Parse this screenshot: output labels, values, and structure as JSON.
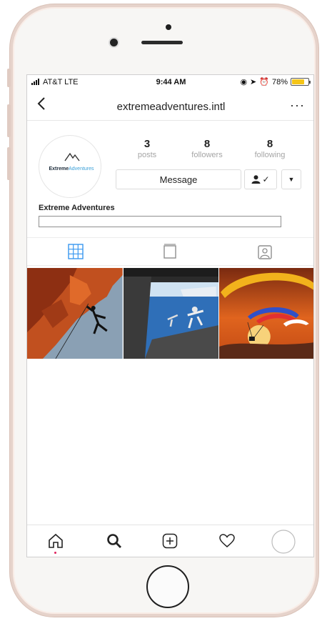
{
  "status_bar": {
    "carrier": "AT&T  LTE",
    "time": "9:44 AM",
    "battery_label": "78%",
    "battery_level": 0.78,
    "battery_color": "#f5c518"
  },
  "nav": {
    "back_icon": "chevron-left-icon",
    "title": "extremeadventures.intl",
    "more_label": "···"
  },
  "profile": {
    "avatar_logo_bold": "Extreme",
    "avatar_logo_light": "Adventures",
    "stats": [
      {
        "count": "3",
        "label": "posts"
      },
      {
        "count": "8",
        "label": "followers"
      },
      {
        "count": "8",
        "label": "following"
      }
    ],
    "message_button": "Message",
    "follow_check": "✓",
    "dropdown_arrow": "▼",
    "name": "Extreme Adventures",
    "bio": ""
  },
  "tabs": [
    {
      "icon": "grid-icon",
      "active": true
    },
    {
      "icon": "feed-icon",
      "active": false
    },
    {
      "icon": "tagged-icon",
      "active": false
    }
  ],
  "posts": [
    {
      "subject": "rock climber on cliff"
    },
    {
      "subject": "skydivers exiting plane"
    },
    {
      "subject": "paragliders at sunset"
    }
  ],
  "bottom_nav": [
    {
      "icon": "home-icon"
    },
    {
      "icon": "search-icon"
    },
    {
      "icon": "add-post-icon"
    },
    {
      "icon": "heart-icon"
    },
    {
      "icon": "profile-avatar-icon"
    }
  ],
  "colors": {
    "accent_blue": "#3897f0",
    "notification_dot": "#e0245e",
    "logo_blue": "#3aa0d8"
  }
}
